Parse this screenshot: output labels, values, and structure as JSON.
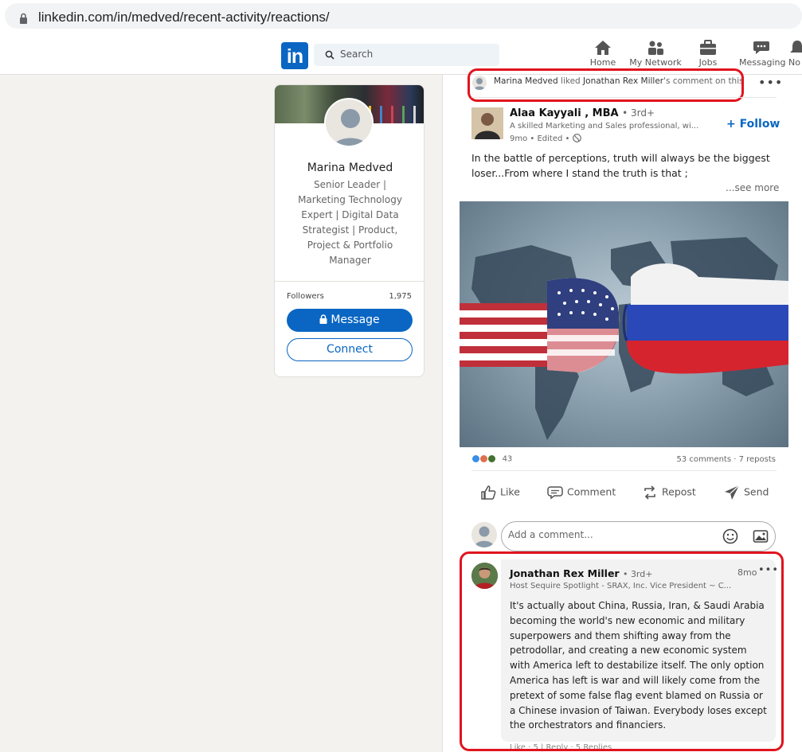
{
  "browser": {
    "url": "linkedin.com/in/medved/recent-activity/reactions/"
  },
  "nav": {
    "search_placeholder": "Search",
    "items": [
      {
        "label": "Home",
        "icon": "home-icon"
      },
      {
        "label": "My Network",
        "icon": "network-icon"
      },
      {
        "label": "Jobs",
        "icon": "briefcase-icon"
      },
      {
        "label": "Messaging",
        "icon": "messaging-icon"
      },
      {
        "label": "No",
        "icon": "bell-icon"
      }
    ]
  },
  "profile": {
    "name": "Marina Medved",
    "headline": "Senior Leader | Marketing Technology Expert | Digital Data Strategist | Product, Project & Portfolio Manager",
    "followers_label": "Followers",
    "followers_count": "1,975",
    "message_label": "Message",
    "connect_label": "Connect"
  },
  "activity": {
    "actor": "Marina Medved",
    "verb": "liked",
    "target": "Jonathan Rex Miller",
    "suffix": "'s comment on this"
  },
  "post": {
    "author": "Alaa Kayyali , MBA",
    "degree": "• 3rd+",
    "author_headline": "A skilled Marketing and Sales professional, wi...",
    "time": "9mo • Edited •",
    "follow_label": "+ Follow",
    "text": "In the battle of perceptions, truth will always be the biggest loser...From where I stand the truth is that ;",
    "see_more": "...see more",
    "reaction_count": "43",
    "comments_reposts": "53 comments · 7 reposts",
    "actions": [
      "Like",
      "Comment",
      "Repost",
      "Send"
    ],
    "comment_placeholder": "Add a comment..."
  },
  "comment": {
    "author": "Jonathan Rex Miller",
    "degree": "• 3rd+",
    "time": "8mo",
    "author_headline": "Host Sequire Spotlight - SRAX, Inc. Vice President ~ C...",
    "text": "It's actually about China, Russia, Iran, & Saudi Arabia becoming the world's new economic and military superpowers and them shifting away from the petrodollar, and creating a new economic system with America left to destabilize itself. The only option America has left is war and will likely come from the pretext of some false flag event blamed on Russia or a Chinese invasion of Taiwan. Everybody loses except the orchestrators and financiers.",
    "footer": "Like · 5 | Reply · 5 Replies"
  },
  "colors": {
    "brand": "#0a66c2",
    "highlight": "#e0141e",
    "background": "#f3f2ef"
  }
}
